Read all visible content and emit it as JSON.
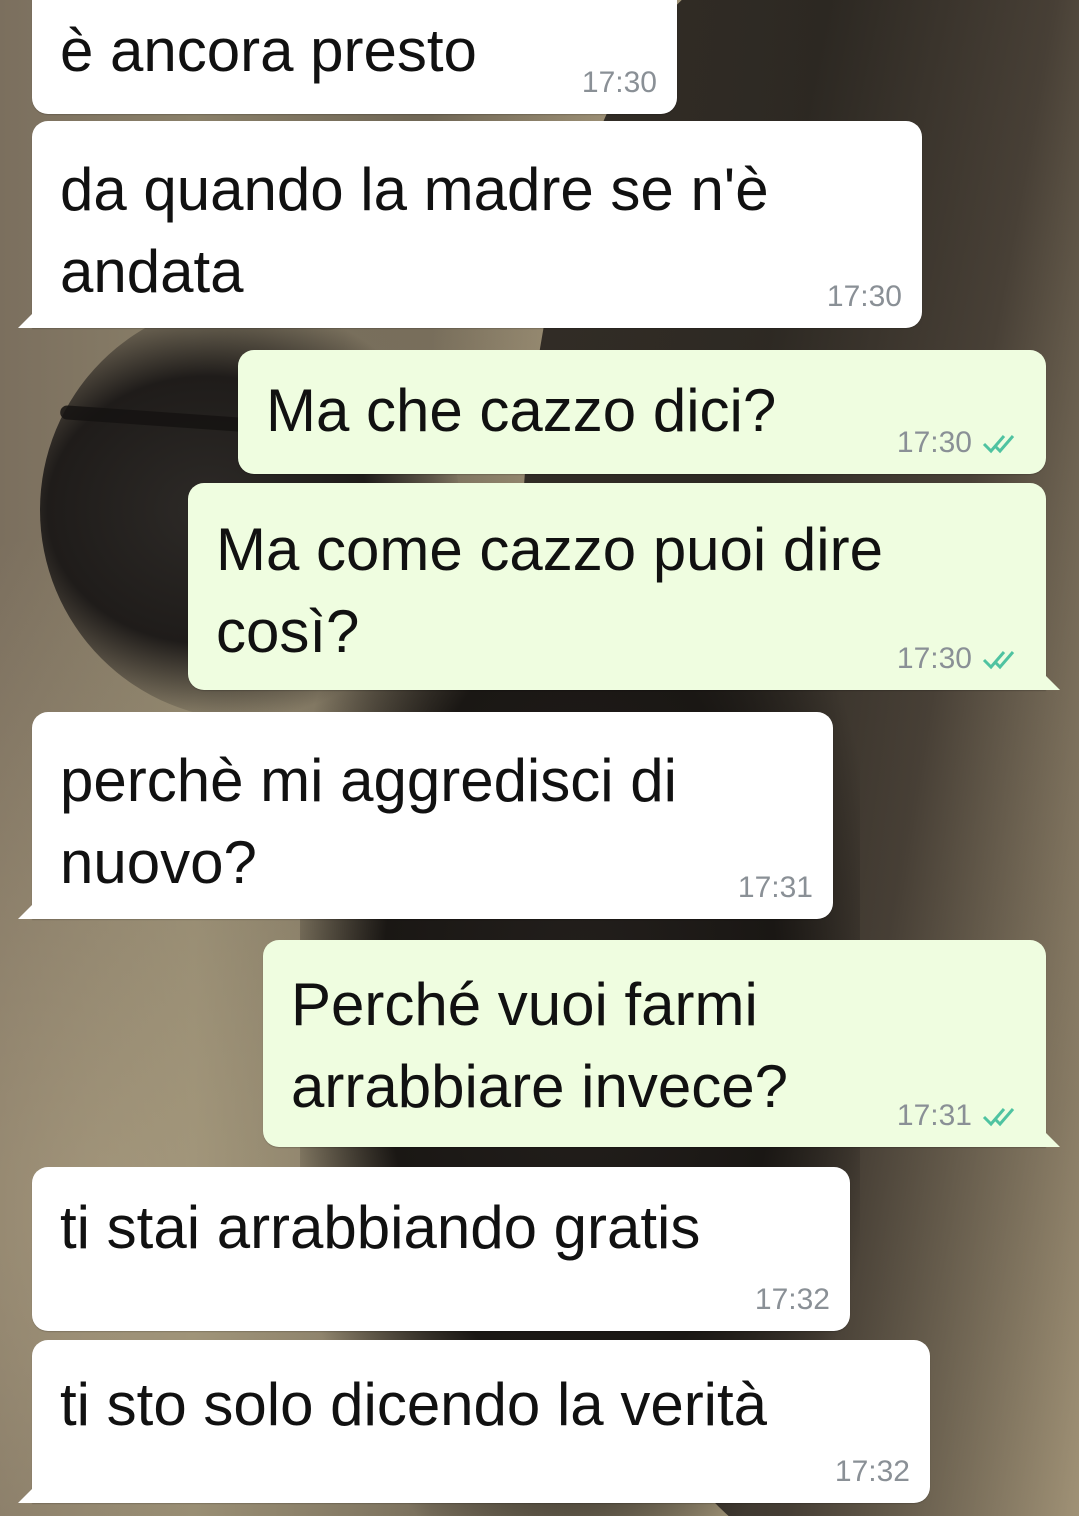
{
  "messages": [
    {
      "text": "è ancora presto",
      "time": "17:30",
      "direction": "in",
      "read": false
    },
    {
      "text": "da quando la madre se n'è\nandata",
      "time": "17:30",
      "direction": "in",
      "read": false
    },
    {
      "text": "Ma che cazzo dici?",
      "time": "17:30",
      "direction": "out",
      "read": true
    },
    {
      "text": "Ma come cazzo puoi dire\ncosì?",
      "time": "17:30",
      "direction": "out",
      "read": true
    },
    {
      "text": "perchè mi aggredisci di\nnuovo?",
      "time": "17:31",
      "direction": "in",
      "read": false
    },
    {
      "text": "Perché vuoi farmi\narrabbiare invece?",
      "time": "17:31",
      "direction": "out",
      "read": true
    },
    {
      "text": "ti stai arrabbiando gratis",
      "time": "17:32",
      "direction": "in",
      "read": false
    },
    {
      "text": "ti sto solo dicendo la verità",
      "time": "17:32",
      "direction": "in",
      "read": false
    }
  ],
  "colors": {
    "incoming_bubble": "#ffffff",
    "outgoing_bubble": "#effde0",
    "read_ticks": "#4fc3a1",
    "timestamp": "#8a9096"
  },
  "icons": {
    "read_receipt": "double-check-icon"
  },
  "wallpaper": {
    "description_icon": "horse-wallpaper"
  }
}
